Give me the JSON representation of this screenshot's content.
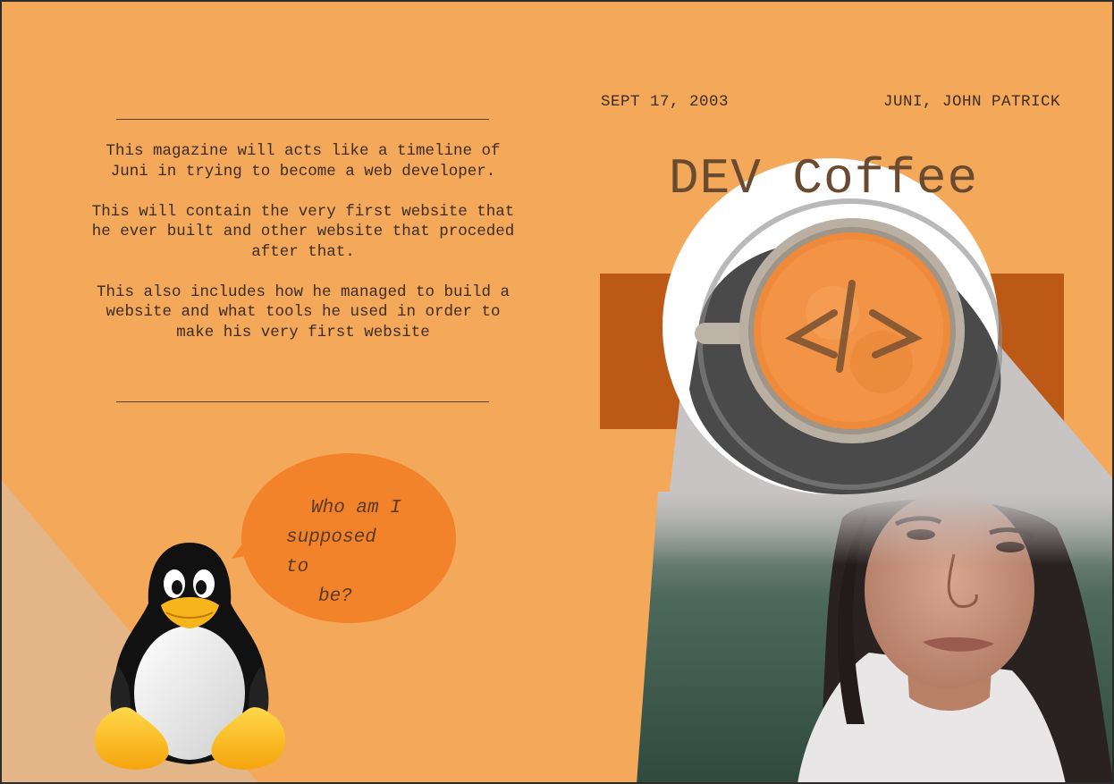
{
  "left_page": {
    "intro_paragraphs": [
      "This magazine will acts like a timeline of Juni in trying to become a web developer.",
      "This will contain the very first website that he ever built and other website that proceded after that.",
      "This also includes how he managed to build a website and what tools he used in order to make his very first website"
    ],
    "speech_lines": [
      "Who am I",
      "supposed to",
      "be?"
    ]
  },
  "right_page": {
    "date": "SEPT 17, 2003",
    "author": "JUNI, JOHN PATRICK",
    "title": "DEV Coffee",
    "cup_symbol": "</>"
  },
  "colors": {
    "background": "#f4a85a",
    "accent_band": "#bd5916",
    "speech_bubble": "#f2832b",
    "light_triangle": "#e3b587",
    "beam": "#c8c4c4",
    "text": "#3d2c20"
  },
  "icons": [
    "tux-penguin-icon",
    "coffee-cup-icon",
    "code-brackets-icon"
  ]
}
